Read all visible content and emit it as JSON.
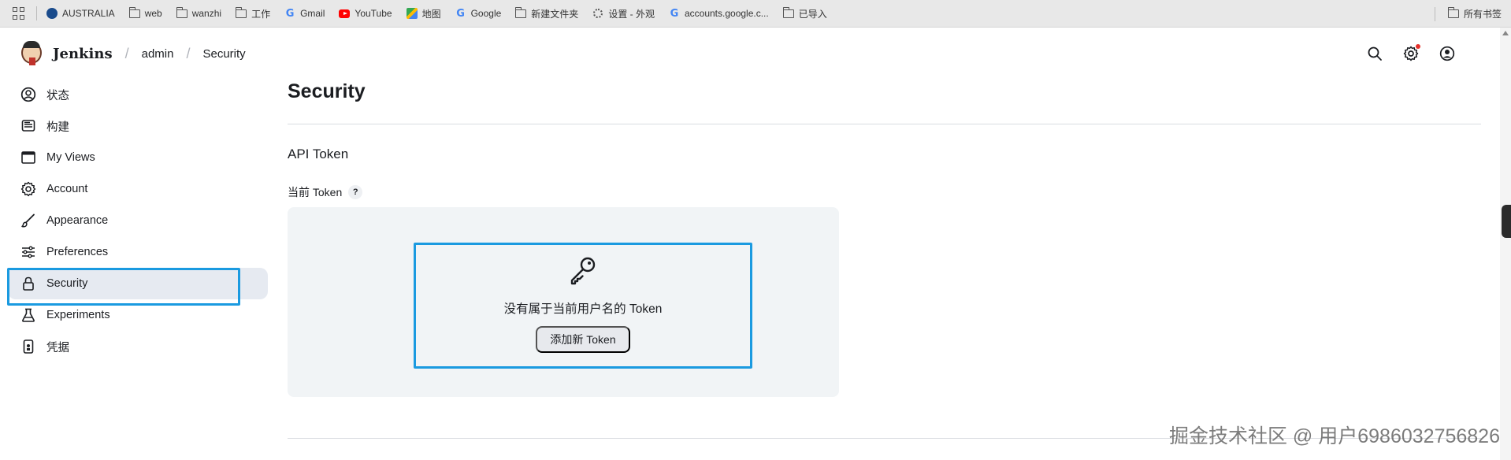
{
  "bookmarks": {
    "items": [
      {
        "label": "AUSTRALIA",
        "icon": "globe-icon"
      },
      {
        "label": "web",
        "icon": "folder-icon"
      },
      {
        "label": "wanzhi",
        "icon": "folder-icon"
      },
      {
        "label": "工作",
        "icon": "folder-icon"
      },
      {
        "label": "Gmail",
        "icon": "google-icon"
      },
      {
        "label": "YouTube",
        "icon": "youtube-icon"
      },
      {
        "label": "地图",
        "icon": "maps-icon"
      },
      {
        "label": "Google",
        "icon": "google-icon"
      },
      {
        "label": "新建文件夹",
        "icon": "folder-icon"
      },
      {
        "label": "设置 - 外观",
        "icon": "gear-icon"
      },
      {
        "label": "accounts.google.c...",
        "icon": "google-icon"
      },
      {
        "label": "已导入",
        "icon": "folder-icon"
      }
    ],
    "all_bookmarks": "所有书签"
  },
  "header": {
    "brand": "Jenkins",
    "crumbs": [
      "admin",
      "Security"
    ],
    "separator": "/"
  },
  "sidebar": {
    "items": [
      {
        "label": "状态",
        "icon": "user-circle-icon"
      },
      {
        "label": "构建",
        "icon": "build-history-icon"
      },
      {
        "label": "My Views",
        "icon": "window-icon"
      },
      {
        "label": "Account",
        "icon": "gear-icon"
      },
      {
        "label": "Appearance",
        "icon": "brush-icon"
      },
      {
        "label": "Preferences",
        "icon": "sliders-icon"
      },
      {
        "label": "Security",
        "icon": "lock-icon",
        "active": true
      },
      {
        "label": "Experiments",
        "icon": "flask-icon"
      },
      {
        "label": "凭据",
        "icon": "credentials-icon"
      }
    ]
  },
  "main": {
    "title": "Security",
    "section": "API Token",
    "field_label": "当前 Token",
    "help": "?",
    "empty_message": "没有属于当前用户名的 Token",
    "add_button": "添加新 Token"
  },
  "watermark": "掘金技术社区 @ 用户6986032756826",
  "colors": {
    "highlight": "#1a9ae0",
    "active_bg": "#e6eaf1",
    "token_box_bg": "#f1f4f6",
    "notification_dot": "#e5302a"
  }
}
